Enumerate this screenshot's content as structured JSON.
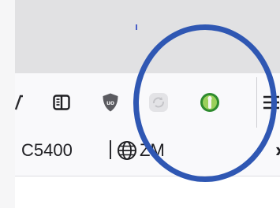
{
  "bookmarks": {
    "item1_label": "C5400",
    "separator": "|",
    "item2_label": "ZM",
    "overflow_label": "»"
  },
  "toolbar": {
    "icons": [
      "reader-view-icon",
      "ublock-origin-icon",
      "sync-extension-icon",
      "green-extension-icon",
      "menu-icon"
    ]
  },
  "colors": {
    "annotation_circle": "#2f57b3",
    "tabstrip": "#e1e1e3",
    "toolbar": "#f9f9fb"
  }
}
